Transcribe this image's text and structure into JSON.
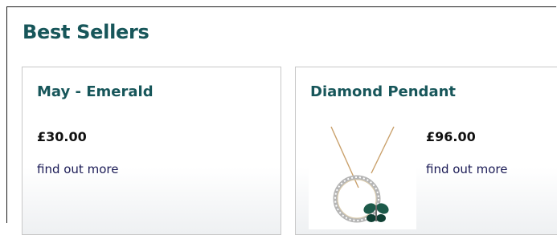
{
  "section": {
    "title": "Best Sellers"
  },
  "products": [
    {
      "name": "May - Emerald",
      "price": "£30.00",
      "link_label": "find out more"
    },
    {
      "name": "Diamond Pendant",
      "price": "£96.00",
      "link_label": "find out more",
      "image": "pendant-necklace-image"
    }
  ],
  "colors": {
    "heading": "#17565a",
    "link": "#1a1a55",
    "card_border": "#c8c8c8"
  }
}
